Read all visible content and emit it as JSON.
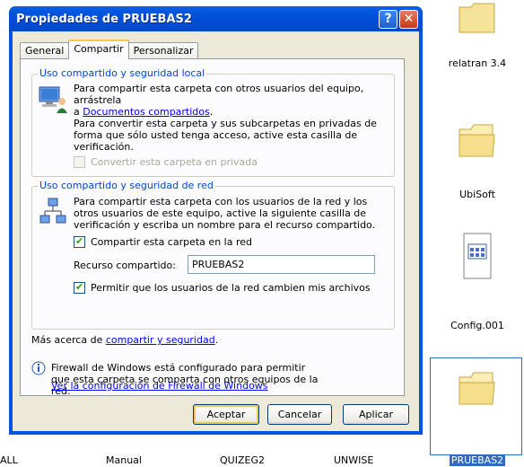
{
  "window": {
    "title": "Propiedades de PRUEBAS2",
    "help_btn": "?",
    "close_btn": "✕"
  },
  "tabs": [
    {
      "label": "General"
    },
    {
      "label": "Compartir"
    },
    {
      "label": "Personalizar"
    }
  ],
  "local_sharing": {
    "legend": "Uso compartido y seguridad local",
    "text1_a": "Para compartir esta carpeta con otros usuarios del equipo, arrástrela",
    "text1_b_prefix": "a ",
    "text1_link": "Documentos compartidos",
    "text1_suffix": ".",
    "text2": "Para convertir esta carpeta y sus subcarpetas en privadas de forma que sólo usted tenga acceso, active esta casilla de verificación.",
    "private_checkbox_label": "Convertir esta carpeta en privada",
    "private_checked": false
  },
  "network_sharing": {
    "legend": "Uso compartido y seguridad de red",
    "text": "Para compartir esta carpeta con los usuarios de la red y los otros usuarios de este equipo, active la siguiente casilla de verificación y escriba un nombre para el recurso compartido.",
    "share_checkbox_label": "Compartir esta carpeta en la red",
    "share_checked": true,
    "share_name_label": "Recurso compartido:",
    "share_name_value": "PRUEBAS2",
    "allow_change_label": "Permitir que los usuarios de la red cambien mis archivos",
    "allow_change_checked": true
  },
  "more_info": {
    "prefix": "Más acerca de ",
    "link": "compartir y seguridad",
    "suffix": "."
  },
  "firewall": {
    "text": "Firewall de Windows está configurado para permitir que esta carpeta se comparta con otros equipos de la red.",
    "link": "Ver la configuración de Firewall de Windows"
  },
  "buttons": {
    "ok": "Aceptar",
    "cancel": "Cancelar",
    "apply": "Aplicar"
  },
  "background_items": {
    "right_column": [
      {
        "label": "relatran 3.4",
        "icon": "folder-icon"
      },
      {
        "label": "UbiSoft",
        "icon": "folder-icon"
      },
      {
        "label": "Config.001",
        "icon": "file-icon"
      },
      {
        "label": "PRUEBAS2",
        "icon": "folder-icon",
        "selected": true
      }
    ],
    "bottom_row": [
      {
        "label": "ALL"
      },
      {
        "label": "Manual"
      },
      {
        "label": "QUIZEG2"
      },
      {
        "label": "UNWISE"
      }
    ]
  }
}
